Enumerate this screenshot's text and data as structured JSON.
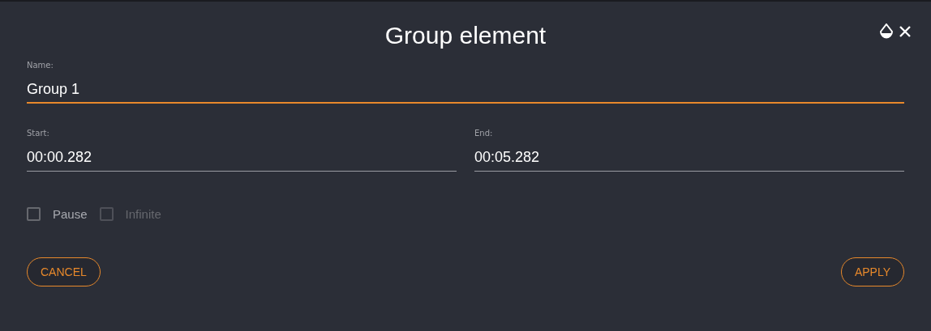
{
  "dialog": {
    "title": "Group element"
  },
  "name_field": {
    "label": "Name:",
    "value": "Group 1",
    "focused": true
  },
  "time_fields": [
    {
      "label": "Start:",
      "value": "00:00.282",
      "focused": false
    },
    {
      "label": "End:",
      "value": "00:05.282",
      "focused": false
    }
  ],
  "checkboxes": [
    {
      "label": "Pause",
      "checked": false,
      "disabled": false
    },
    {
      "label": "Infinite",
      "checked": false,
      "disabled": true
    }
  ],
  "buttons": [
    {
      "label": "CANCEL"
    },
    {
      "label": "APPLY"
    }
  ]
}
